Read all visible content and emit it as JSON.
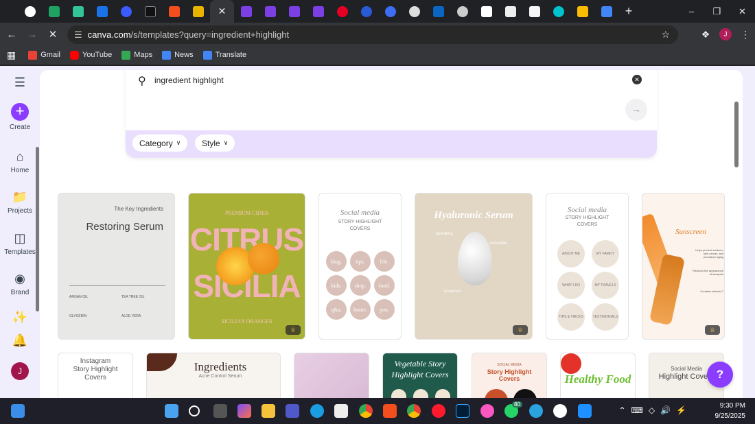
{
  "browser": {
    "active_tab_close": "✕",
    "new_tab": "+",
    "url_site": "canva.com",
    "url_path": "/s/templates?query=ingredient+highlight",
    "profile_initial": "J",
    "bookmarks": [
      {
        "label": "Gmail",
        "color": "#ea4335"
      },
      {
        "label": "YouTube",
        "color": "#ff0000"
      },
      {
        "label": "Maps",
        "color": "#34a853"
      },
      {
        "label": "News",
        "color": "#4285f4"
      },
      {
        "label": "Translate",
        "color": "#4285f4"
      }
    ]
  },
  "rail": {
    "create": "Create",
    "home": "Home",
    "projects": "Projects",
    "templates": "Templates",
    "brand": "Brand",
    "avatar_initial": "J"
  },
  "search": {
    "query": "ingredient highlight",
    "category_label": "Category",
    "style_label": "Style"
  },
  "cards": {
    "c1_small": "The Key Ingredients",
    "c1_title": "Restoring Serum",
    "c1_i1": "ARGAN OIL",
    "c1_i2": "TEA TREE OIL",
    "c1_i3": "GLYCERIN",
    "c1_i4": "ALOE VERA",
    "c2_top": "PREMIUM CIDER",
    "c2_l1": "CITRUS",
    "c2_l2": "SICILIA",
    "c2_bottom": "SICILIAN ORANGES",
    "c3_script": "Social media",
    "c3_sub1": "STORY HIGHLIGHT",
    "c3_sub2": "COVERS",
    "c3_circles": [
      "blog.",
      "tips.",
      "life.",
      "kids.",
      "shop.",
      "food.",
      "q&a.",
      "home.",
      "you."
    ],
    "c4_title": "Hyaluronic Serum",
    "c4_l1": "hydrating",
    "c4_l2": "protection",
    "c4_l3": "universal",
    "c5_script": "Social media",
    "c5_sub1": "STORY HIGHLIGHT",
    "c5_sub2": "COVERS",
    "c5_circles": [
      "ABOUT ME",
      "MY FAMILY",
      "WHAT I DO",
      "MY TRAVELS",
      "TIPS & TRICKS",
      "TESTIMONIALS"
    ],
    "c6_title": "Sunscreen",
    "c6_n1": "helps prevent sunburn, skin cancer, and premature aging",
    "c6_n2": "Reduces the appearance of sunspots",
    "c6_n3": "Contains vitamin C",
    "r2_1a": "Instagram",
    "r2_1b": "Story Highlight",
    "r2_1c": "Covers",
    "r2_2a": "Ingredients",
    "r2_2b": "Acne Control Serum",
    "r2_4a": "Vegetable Story",
    "r2_4b": "Highlight Covers",
    "r2_5a": "SOCIAL MEDIA",
    "r2_5b": "Story Highlight",
    "r2_5c": "Covers",
    "r2_6a": "Healthy Food",
    "r2_7a": "Social Media",
    "r2_7b": "Highlight Covers"
  },
  "help_label": "?",
  "taskbar": {
    "time": "9:30 PM",
    "date": "9/25/2025",
    "badge": "80"
  },
  "colors": {
    "canva_purple": "#8b3dff",
    "panel_lavender": "#e9defd"
  }
}
